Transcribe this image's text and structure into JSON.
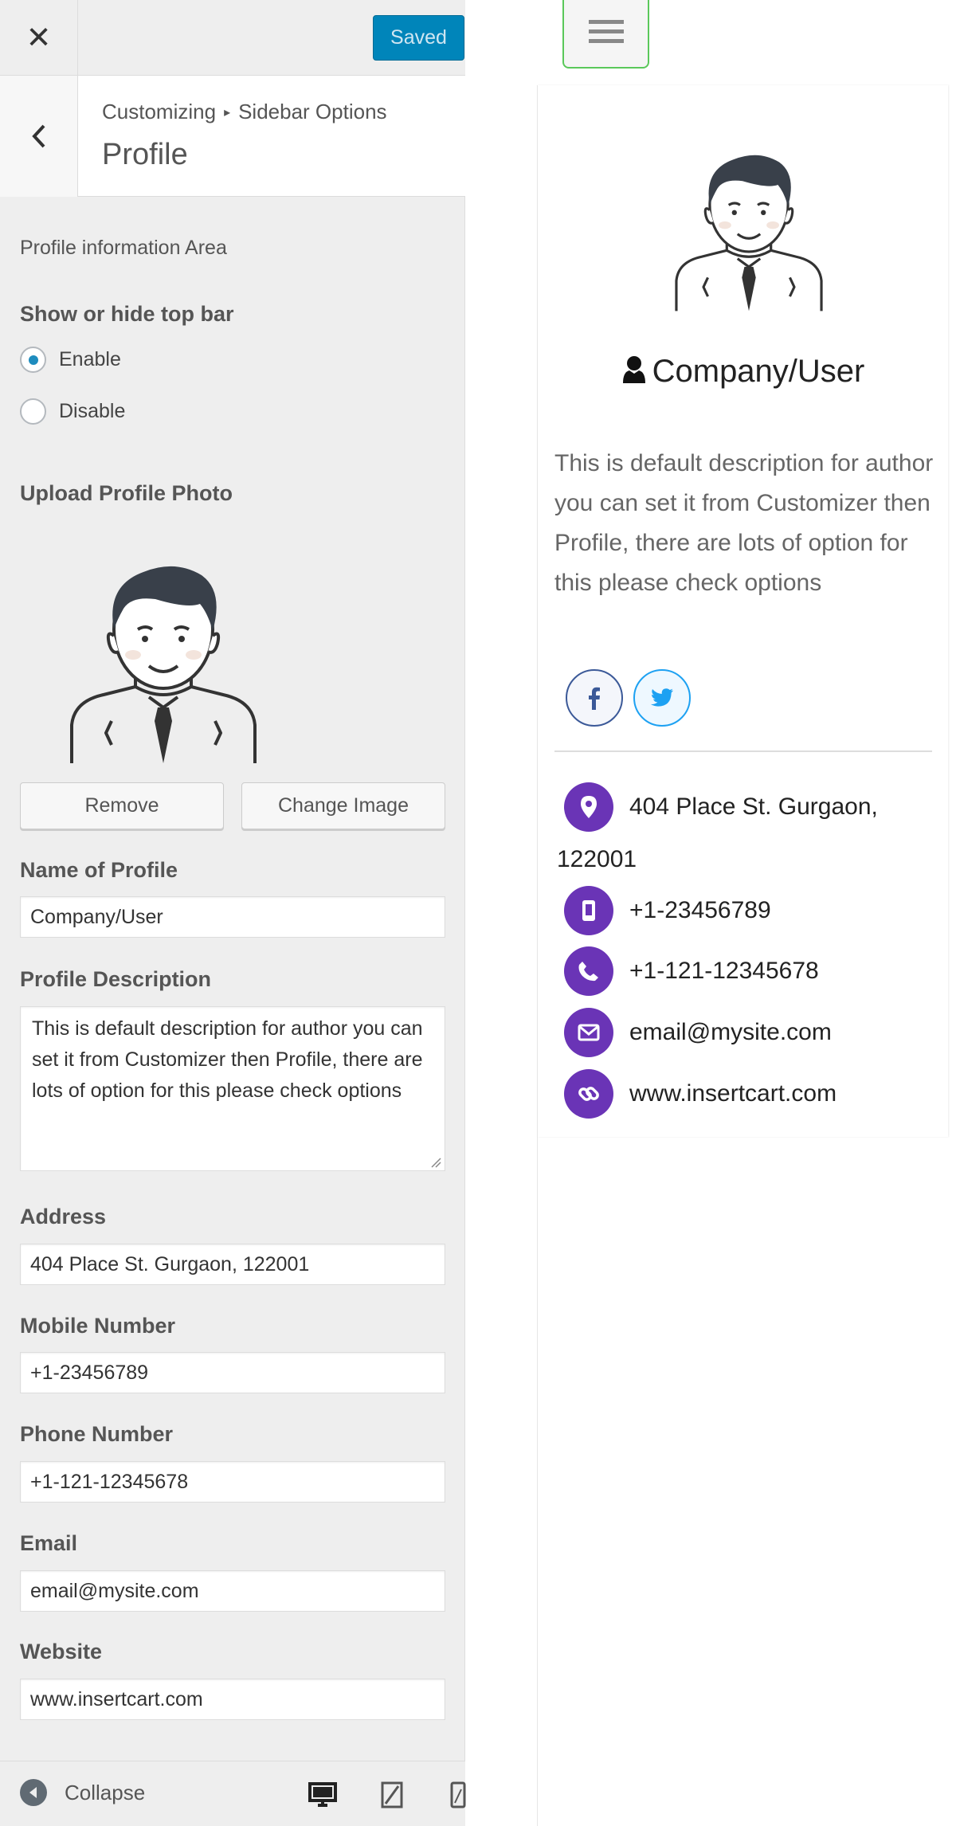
{
  "customizer": {
    "close_label": "✕",
    "save_label": "Saved",
    "breadcrumb_root": "Customizing",
    "breadcrumb_parent": "Sidebar Options",
    "section_title": "Profile",
    "area_description": "Profile information Area",
    "topbar_toggle": {
      "label": "Show or hide top bar",
      "options": [
        "Enable",
        "Disable"
      ],
      "selected": "Enable"
    },
    "upload_label": "Upload Profile Photo",
    "remove_label": "Remove",
    "change_image_label": "Change Image",
    "fields": {
      "name": {
        "label": "Name of Profile",
        "value": "Company/User"
      },
      "description": {
        "label": "Profile Description",
        "value": "This is default description for author you can set it from Customizer then Profile, there are lots of option for this please check options"
      },
      "address": {
        "label": "Address",
        "value": "404 Place St. Gurgaon, 122001"
      },
      "mobile": {
        "label": "Mobile Number",
        "value": "+1-23456789"
      },
      "phone": {
        "label": "Phone Number",
        "value": "+1-121-12345678"
      },
      "email": {
        "label": "Email",
        "value": "email@mysite.com"
      },
      "website": {
        "label": "Website",
        "value": "www.insertcart.com"
      }
    },
    "footer": {
      "collapse_label": "Collapse",
      "devices": [
        "desktop-icon",
        "tablet-icon",
        "mobile-icon"
      ]
    }
  },
  "preview": {
    "profile_name": "Company/User",
    "description": "This is default description for author you can set it from Customizer then Profile, there are lots of option for this please check options",
    "social": [
      "facebook-icon",
      "twitter-icon"
    ],
    "contact": {
      "address_line1": "404 Place St. Gurgaon,",
      "address_line2": "122001",
      "mobile": "+1-23456789",
      "phone": "+1-121-12345678",
      "email": "email@mysite.com",
      "website": "www.insertcart.com"
    }
  },
  "colors": {
    "accent_blue": "#0085ba",
    "contact_purple": "#6a34b6",
    "facebook": "#3b5998",
    "twitter": "#1da1f2",
    "menu_border_green": "#5ac85a"
  }
}
